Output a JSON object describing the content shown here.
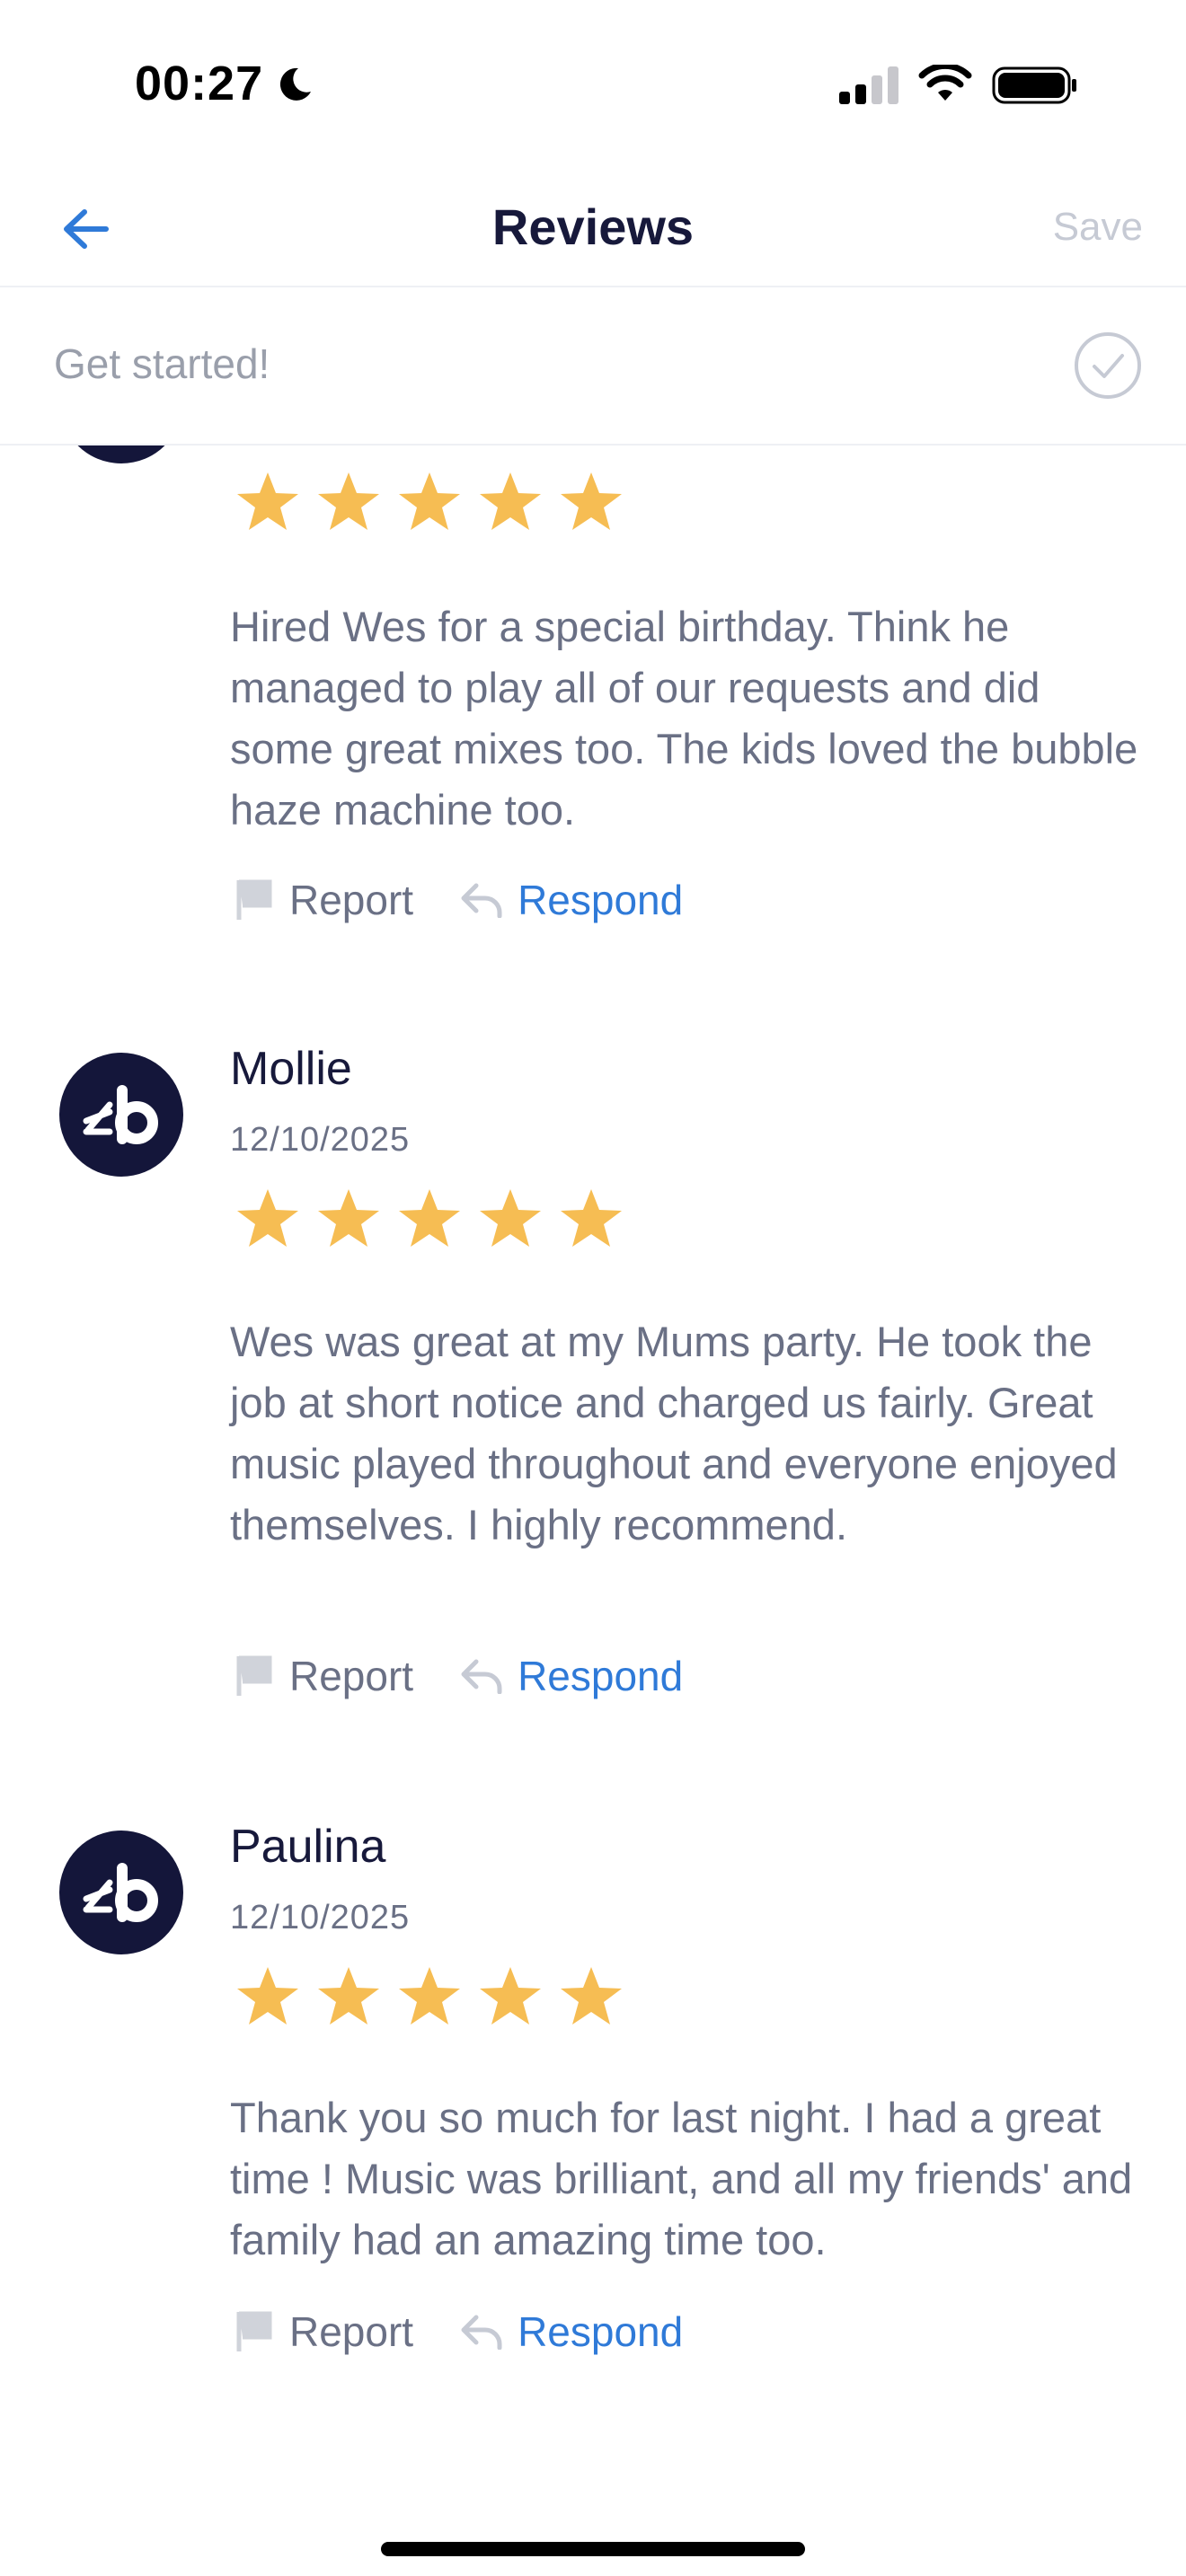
{
  "status_bar": {
    "time": "00:27"
  },
  "nav": {
    "title": "Reviews",
    "save_label": "Save"
  },
  "banner": {
    "label": "Get started!"
  },
  "reviews": [
    {
      "name": "",
      "date": "",
      "rating": 5,
      "text": "Hired Wes for a special birthday. Think he managed to play all of our requests and did some great mixes too. The kids loved the bubble haze machine too.",
      "report_label": "Report",
      "respond_label": "Respond"
    },
    {
      "name": "Mollie",
      "date": "12/10/2025",
      "rating": 5,
      "text": "Wes was great at my Mums party. He took the job at short notice and charged us fairly. Great music played throughout and everyone enjoyed themselves. I highly recommend.",
      "report_label": "Report",
      "respond_label": "Respond"
    },
    {
      "name": "Paulina",
      "date": "12/10/2025",
      "rating": 5,
      "text": "Thank you so much for last night. I had a great time ! Music was brilliant, and all my friends' and family had an amazing time too.",
      "report_label": "Report",
      "respond_label": "Respond"
    }
  ],
  "colors": {
    "accent": "#2f7ad8",
    "star": "#f6bd53",
    "avatar_bg": "#14163a",
    "title": "#17193b",
    "muted": "#6a7085"
  },
  "icons": [
    "moon-icon",
    "signal-icon",
    "wifi-icon",
    "battery-icon",
    "back-arrow-icon",
    "check-circle-icon",
    "star-icon",
    "flag-icon",
    "reply-icon",
    "avatar-logo"
  ]
}
